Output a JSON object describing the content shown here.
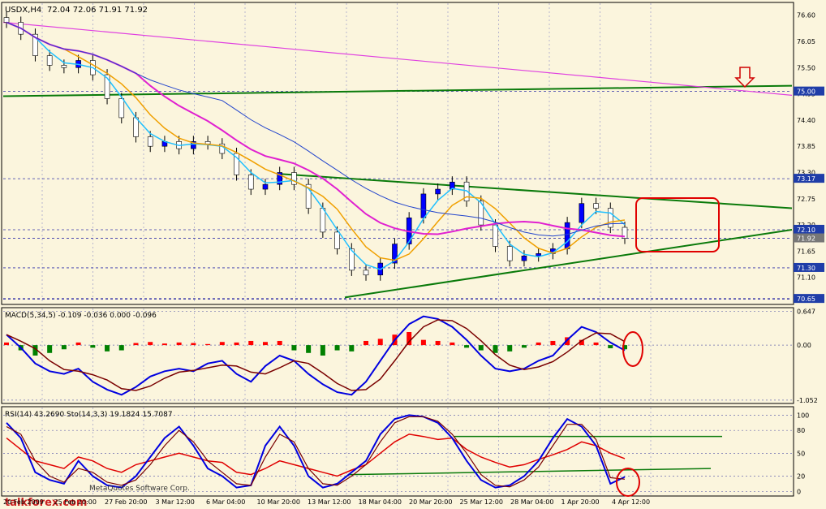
{
  "chart_data": [
    {
      "type": "candlestick",
      "panel": "price",
      "title": "USDX,H4",
      "ohlc_header": "72.04 72.06 71.91 71.92",
      "y_ticks": [
        "76.60",
        "76.05",
        "75.50",
        "74.95",
        "74.40",
        "73.85",
        "73.30",
        "72.75",
        "72.20",
        "71.65",
        "71.10"
      ],
      "price_labels": [
        "75.00",
        "73.17",
        "72.10",
        "71.92",
        "71.30",
        "70.65"
      ],
      "ylim": [
        70.55,
        76.85
      ],
      "series": [
        {
          "name": "close",
          "values": [
            76.45,
            76.2,
            75.75,
            75.55,
            75.5,
            75.65,
            75.35,
            74.85,
            74.45,
            74.05,
            73.85,
            73.95,
            73.8,
            73.95,
            73.9,
            73.7,
            73.25,
            72.95,
            73.05,
            73.3,
            73.05,
            72.55,
            72.05,
            71.7,
            71.25,
            71.15,
            71.4,
            71.8,
            72.35,
            72.85,
            72.95,
            73.1,
            72.7,
            72.2,
            71.75,
            71.45,
            71.55,
            71.6,
            71.7,
            72.25,
            72.65,
            72.55,
            72.15,
            71.92
          ]
        }
      ],
      "annotations": [
        "down arrow at 75.00",
        "target box at 72.75 to 71.65",
        "ascending and descending trend lines"
      ]
    },
    {
      "type": "histogram",
      "panel": "macd",
      "title": "MACD(5,34,5) -0.109 -0.036 0.000 -0.096",
      "y_ticks": [
        "0.647",
        "0.00",
        "-1.052"
      ],
      "ylim": [
        -1.1,
        0.7
      ],
      "series": [
        {
          "name": "histogram",
          "values": [
            0.05,
            -0.1,
            -0.2,
            -0.15,
            -0.08,
            0.05,
            -0.05,
            -0.12,
            -0.1,
            0.04,
            0.06,
            0.03,
            0.05,
            0.04,
            0.02,
            0.06,
            0.05,
            0.08,
            0.06,
            0.08,
            -0.1,
            -0.15,
            -0.2,
            -0.1,
            -0.12,
            0.08,
            0.12,
            0.2,
            0.25,
            0.1,
            0.08,
            0.05,
            -0.05,
            -0.1,
            -0.15,
            -0.12,
            -0.05,
            0.05,
            0.08,
            0.15,
            0.1,
            0.05,
            -0.06,
            -0.08
          ]
        },
        {
          "name": "macd",
          "values": [
            0.2,
            -0.05,
            -0.35,
            -0.5,
            -0.55,
            -0.45,
            -0.7,
            -0.85,
            -0.95,
            -0.8,
            -0.6,
            -0.5,
            -0.45,
            -0.5,
            -0.35,
            -0.3,
            -0.55,
            -0.7,
            -0.4,
            -0.2,
            -0.3,
            -0.55,
            -0.75,
            -0.9,
            -0.95,
            -0.7,
            -0.3,
            0.1,
            0.4,
            0.55,
            0.5,
            0.35,
            0.1,
            -0.2,
            -0.45,
            -0.5,
            -0.45,
            -0.3,
            -0.2,
            0.1,
            0.35,
            0.25,
            0.05,
            -0.1
          ]
        }
      ]
    },
    {
      "type": "line",
      "panel": "rsi_stochastic",
      "title": "RSI(14) 43.2690  Sto(14,3,3) 19.1824 15.7087",
      "y_ticks": [
        "100",
        "80",
        "50",
        "20",
        "0"
      ],
      "ylim": [
        -5,
        110
      ],
      "series": [
        {
          "name": "RSI(14)",
          "values": [
            70,
            55,
            40,
            35,
            30,
            45,
            40,
            30,
            25,
            35,
            40,
            45,
            50,
            45,
            40,
            38,
            25,
            22,
            30,
            40,
            35,
            30,
            25,
            20,
            28,
            35,
            50,
            65,
            75,
            72,
            68,
            70,
            55,
            45,
            38,
            32,
            35,
            42,
            48,
            55,
            65,
            60,
            50,
            43
          ]
        },
        {
          "name": "Sto main",
          "values": [
            90,
            70,
            25,
            15,
            10,
            40,
            20,
            8,
            5,
            20,
            45,
            70,
            85,
            60,
            30,
            20,
            5,
            8,
            60,
            85,
            60,
            20,
            5,
            10,
            25,
            40,
            75,
            95,
            100,
            98,
            90,
            70,
            40,
            15,
            5,
            8,
            20,
            40,
            70,
            95,
            85,
            60,
            10,
            19
          ]
        },
        {
          "name": "Sto signal",
          "values": [
            85,
            75,
            40,
            20,
            12,
            30,
            25,
            12,
            8,
            15,
            35,
            60,
            80,
            65,
            40,
            25,
            10,
            8,
            45,
            75,
            65,
            30,
            10,
            8,
            20,
            35,
            65,
            90,
            98,
            98,
            92,
            75,
            50,
            22,
            8,
            6,
            15,
            32,
            60,
            88,
            88,
            68,
            18,
            16
          ]
        }
      ]
    }
  ],
  "x_ticks": [
    "20 Feb 2009",
    "25 Feb 20:00",
    "27 Feb 20:00",
    "3 Mar 12:00",
    "6 Mar 04:00",
    "10 Mar 20:00",
    "13 Mar 12:00",
    "18 Mar 04:00",
    "20 Mar 20:00",
    "25 Mar 12:00",
    "28 Mar 04:00",
    "1 Apr 20:00",
    "4 Apr 12:00"
  ],
  "copyright": "MetaQuotes Software Corp.",
  "watermark": "talkforex.com",
  "colors": {
    "background": "#fbf5dd",
    "bull": "#0000ff",
    "bear": "#ffffff",
    "hist_up": "#ff0000",
    "hist_down": "#008000",
    "grid": "#9b9bc8"
  }
}
